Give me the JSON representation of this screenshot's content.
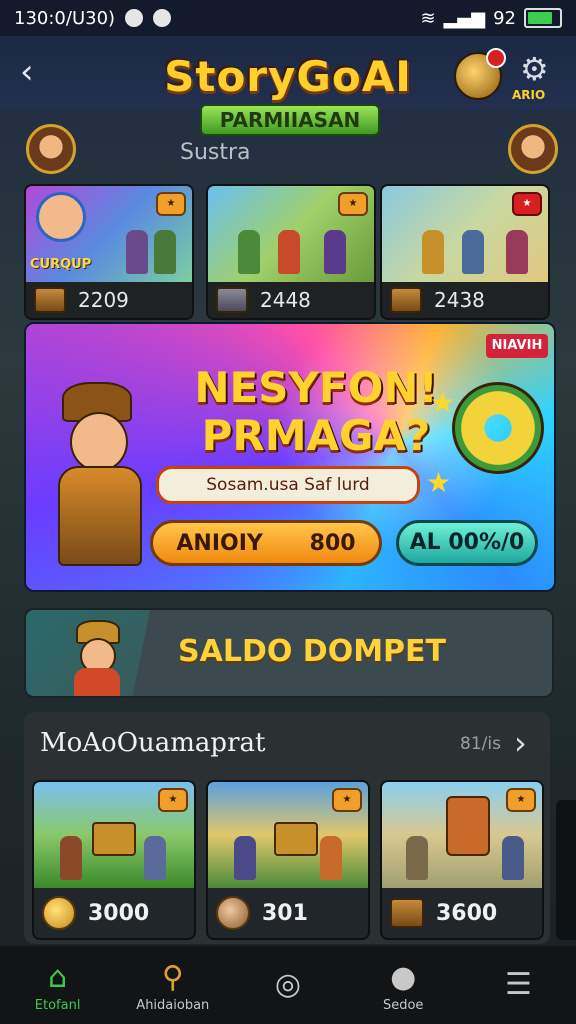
{
  "status_bar": {
    "time": "130:0/U30)",
    "right_text": "92"
  },
  "header": {
    "logo_main": "StoryGoAI",
    "logo_sub": "PARMIIASAN",
    "settings_label": "ARIO",
    "subtitle": "Sustra"
  },
  "top_cards": [
    {
      "tag": "CURQUP",
      "value": "2209"
    },
    {
      "tag": "",
      "value": "2448"
    },
    {
      "tag": "",
      "value": "2438"
    }
  ],
  "banner": {
    "tag": "NIAVIH",
    "title_line1": "NESYFON!",
    "title_line2": "PRMAGA?",
    "subtitle": "Sosam.usa Saf lurd",
    "primary_label": "ANIOIY",
    "primary_value": "800",
    "secondary_label": "AL 00%/0"
  },
  "wallet": {
    "label": "SALDO DOMPET"
  },
  "section": {
    "title": "MoAoOuamaprat",
    "count": "81/is",
    "items": [
      {
        "value": "3000"
      },
      {
        "value": "301"
      },
      {
        "value": "3600"
      }
    ]
  },
  "nav": {
    "items": [
      {
        "label": "Etofanl",
        "icon": "home-icon"
      },
      {
        "label": "Ahidaioban",
        "icon": "magnifier-icon"
      },
      {
        "label": "",
        "icon": "compass-icon"
      },
      {
        "label": "Sedoe",
        "icon": "bag-icon"
      },
      {
        "label": "",
        "icon": "menu-icon"
      }
    ]
  },
  "colors": {
    "accent_gold": "#ffcf2e",
    "active_nav": "#3ec84a",
    "banner_tag": "#d3223a"
  }
}
